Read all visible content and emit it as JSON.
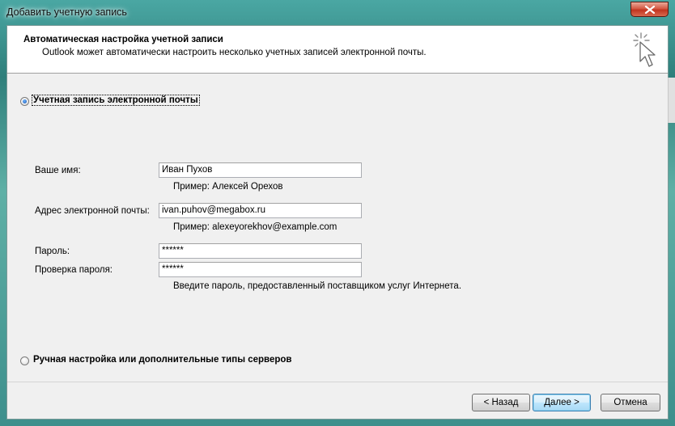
{
  "window": {
    "title": "Добавить учетную запись"
  },
  "header": {
    "title": "Автоматическая настройка учетной записи",
    "subtitle": "Outlook может автоматически настроить несколько учетных записей электронной почты."
  },
  "options": {
    "email_account": "Учетная запись электронной почты",
    "manual": "Ручная настройка или дополнительные типы серверов"
  },
  "form": {
    "name_label": "Ваше имя:",
    "name_value": "Иван Пухов",
    "name_hint": "Пример: Алексей Орехов",
    "email_label": "Адрес электронной почты:",
    "email_value": "ivan.puhov@megabox.ru",
    "email_hint": "Пример: alexeyorekhov@example.com",
    "password_label": "Пароль:",
    "password_value": "******",
    "confirm_label": "Проверка пароля:",
    "confirm_value": "******",
    "password_hint": "Введите пароль, предоставленный поставщиком услуг Интернета."
  },
  "buttons": {
    "back": "< Назад",
    "next": "Далее >",
    "cancel": "Отмена"
  },
  "icons": {
    "close": "close-icon",
    "wizard": "cursor-sparkle-icon"
  },
  "colors": {
    "accent": "#3c7fb1",
    "close": "#c2341f",
    "client_bg": "#f0f0f0"
  }
}
